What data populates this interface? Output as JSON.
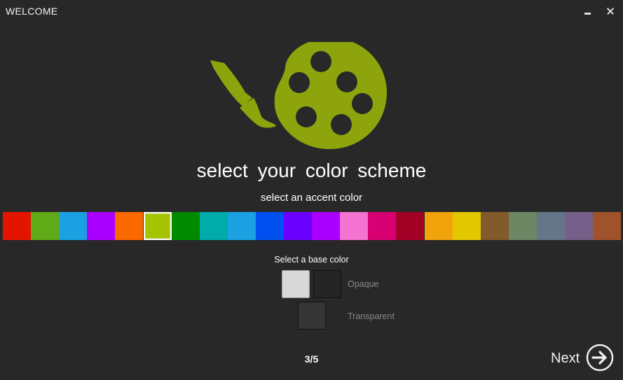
{
  "window": {
    "title": "WELCOME",
    "minimize_icon": "minimize-icon",
    "close_icon": "close-icon"
  },
  "hero": {
    "icon": "palette-brush-icon",
    "color": "#8ea40c"
  },
  "heading": "select your color scheme",
  "accent": {
    "label": "select an accent color",
    "selected_index": 5,
    "colors": [
      "#e51400",
      "#60a917",
      "#1ba1e2",
      "#aa00ff",
      "#fa6800",
      "#a4c400",
      "#008a00",
      "#00aba9",
      "#1ba1e2",
      "#0050ef",
      "#6a00ff",
      "#aa00ff",
      "#f472d0",
      "#d80073",
      "#a20025",
      "#f0a30a",
      "#e3c800",
      "#825a2c",
      "#6d8764",
      "#647687",
      "#76608a",
      "#a0522d"
    ]
  },
  "base": {
    "label": "Select a base color",
    "options": [
      {
        "name": "light",
        "color": "#d8d8d8"
      },
      {
        "name": "dark",
        "color": "#252525"
      },
      {
        "name": "transparent",
        "color": "#353535"
      }
    ],
    "opaque_label": "Opaque",
    "transparent_label": "Transparent"
  },
  "step": "3/5",
  "next": {
    "label": "Next",
    "icon": "arrow-right-circle-icon"
  }
}
